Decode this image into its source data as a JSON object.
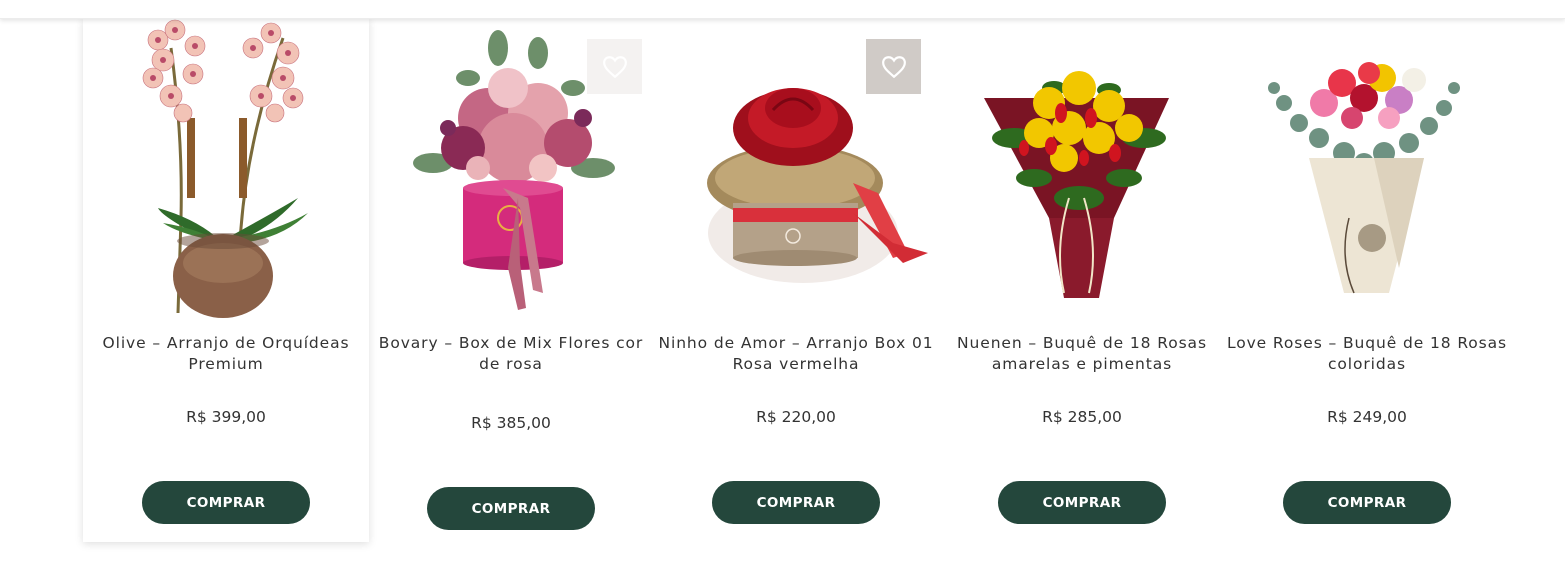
{
  "products": [
    {
      "name": "Olive – Arranjo de Orquídeas Premium",
      "price": "R$ 399,00",
      "button": "COMPRAR"
    },
    {
      "name": "Bovary – Box de Mix Flores cor de rosa",
      "price": "R$ 385,00",
      "button": "COMPRAR"
    },
    {
      "name": "Ninho de Amor – Arranjo Box 01 Rosa vermelha",
      "price": "R$ 220,00",
      "button": "COMPRAR"
    },
    {
      "name": "Nuenen – Buquê de 18 Rosas amarelas e pimentas",
      "price": "R$ 285,00",
      "button": "COMPRAR"
    },
    {
      "name": "Love Roses – Buquê de 18 Rosas coloridas",
      "price": "R$ 249,00",
      "button": "COMPRAR"
    }
  ],
  "icons": {
    "favorite": "heart-icon"
  },
  "colors": {
    "button": "#24473c",
    "button_text": "#ffffff",
    "text": "#333333"
  }
}
